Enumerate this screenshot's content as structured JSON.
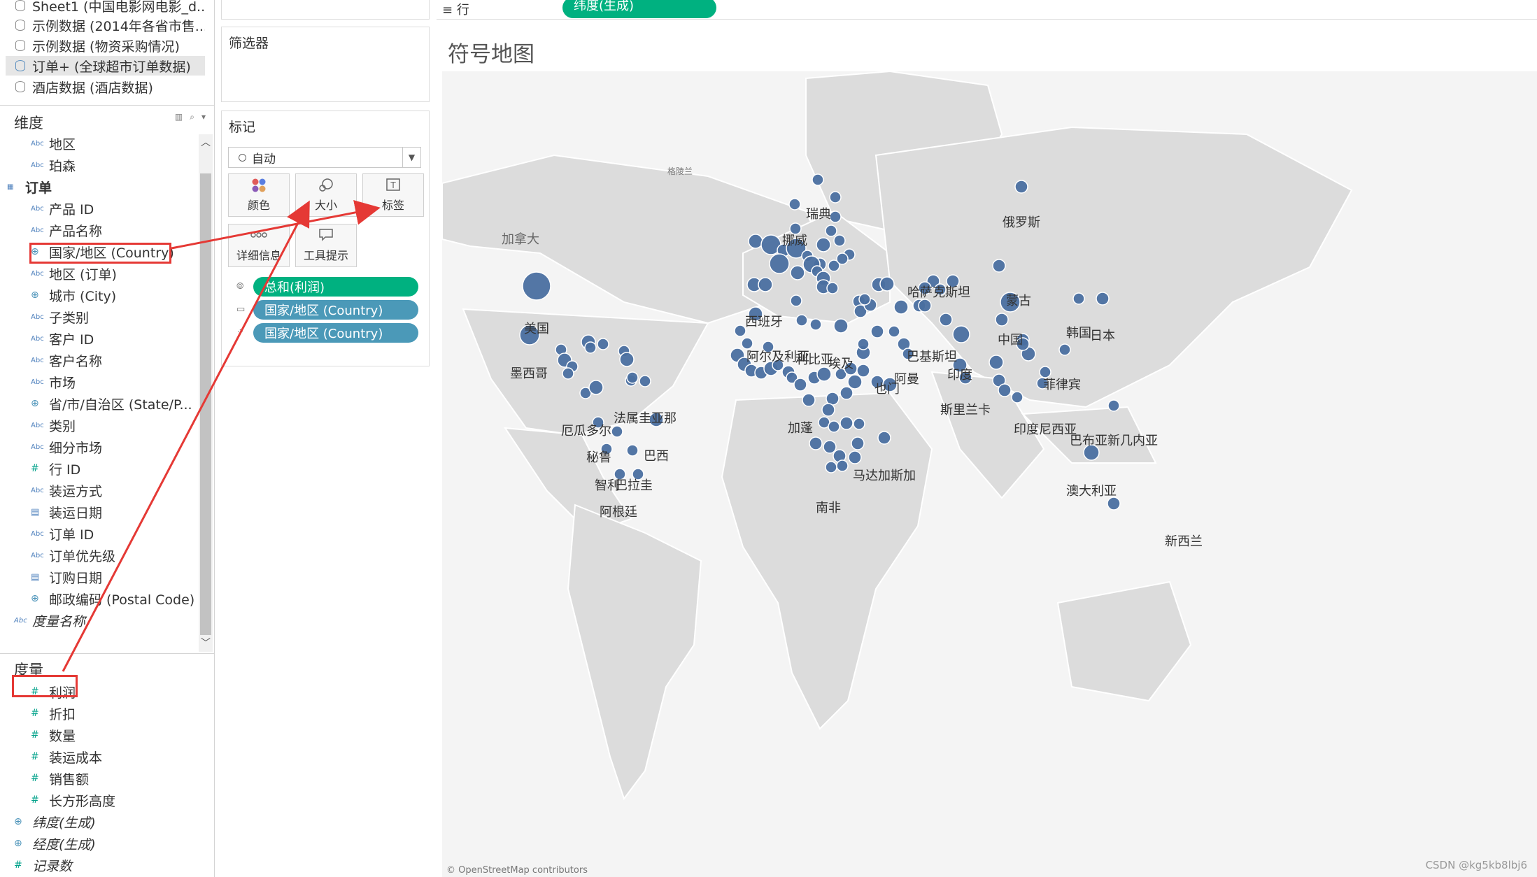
{
  "datasources": [
    {
      "label": "Sheet1 (中国电影网电影_d..."
    },
    {
      "label": "示例数据 (2014年各省市售..."
    },
    {
      "label": "示例数据 (物资采购情况)"
    },
    {
      "label": "订单+ (全球超市订单数据)"
    },
    {
      "label": "酒店数据 (酒店数据)"
    }
  ],
  "dimensions_title": "维度",
  "dimension_fields": [
    {
      "label": "地区",
      "type": "Abc"
    },
    {
      "label": "珀森",
      "type": "Abc"
    },
    {
      "label": "订单",
      "type": "group"
    },
    {
      "label": "产品 ID",
      "type": "Abc"
    },
    {
      "label": "产品名称",
      "type": "Abc"
    },
    {
      "label": "国家/地区 (Country)",
      "type": "geo"
    },
    {
      "label": "地区 (订单)",
      "type": "Abc"
    },
    {
      "label": "城市 (City)",
      "type": "geo"
    },
    {
      "label": "子类别",
      "type": "Abc"
    },
    {
      "label": "客户 ID",
      "type": "Abc"
    },
    {
      "label": "客户名称",
      "type": "Abc"
    },
    {
      "label": "市场",
      "type": "Abc"
    },
    {
      "label": "省/市/自治区 (State/P...",
      "type": "geo"
    },
    {
      "label": "类别",
      "type": "Abc"
    },
    {
      "label": "细分市场",
      "type": "Abc"
    },
    {
      "label": "行 ID",
      "type": "num"
    },
    {
      "label": "装运方式",
      "type": "Abc"
    },
    {
      "label": "装运日期",
      "type": "date"
    },
    {
      "label": "订单 ID",
      "type": "Abc"
    },
    {
      "label": "订单优先级",
      "type": "Abc"
    },
    {
      "label": "订购日期",
      "type": "date"
    },
    {
      "label": "邮政编码 (Postal Code)",
      "type": "geo"
    },
    {
      "label": "度量名称",
      "type": "Abc-italic"
    }
  ],
  "measures_title": "度量",
  "measure_fields": [
    {
      "label": "利润",
      "type": "num"
    },
    {
      "label": "折扣",
      "type": "num"
    },
    {
      "label": "数量",
      "type": "num"
    },
    {
      "label": "装运成本",
      "type": "num"
    },
    {
      "label": "销售额",
      "type": "num"
    },
    {
      "label": "长方形高度",
      "type": "num"
    },
    {
      "label": "纬度(生成)",
      "type": "geo-italic"
    },
    {
      "label": "经度(生成)",
      "type": "geo-italic"
    },
    {
      "label": "记录数",
      "type": "num-italic"
    }
  ],
  "filters_title": "筛选器",
  "marks": {
    "title": "标记",
    "type": "自动",
    "buttons": [
      {
        "label": "颜色",
        "icon": "color-icon"
      },
      {
        "label": "大小",
        "icon": "size-icon"
      },
      {
        "label": "标签",
        "icon": "label-icon"
      },
      {
        "label": "详细信息",
        "icon": "detail-icon"
      },
      {
        "label": "工具提示",
        "icon": "tooltip-icon"
      }
    ],
    "pills": [
      {
        "label": "总和(利润)",
        "color": "#00b180",
        "icon": "size-icon"
      },
      {
        "label": "国家/地区 (Country)",
        "color": "#4b99b8",
        "icon": "label-icon"
      },
      {
        "label": "国家/地区 (Country)",
        "color": "#4b99b8",
        "icon": "detail-icon"
      }
    ]
  },
  "rows_shelf": {
    "label": "行",
    "pill": "纬度(生成)"
  },
  "sheet_title": "符号地图",
  "map": {
    "attribution": "© OpenStreetMap contributors",
    "labels": [
      {
        "text": "格陵兰",
        "style": "small"
      },
      {
        "text": "加拿大",
        "style": "grey"
      },
      {
        "text": "美国"
      },
      {
        "text": "墨西哥"
      },
      {
        "text": "厄瓜多尔"
      },
      {
        "text": "法属圭亚那"
      },
      {
        "text": "巴西"
      },
      {
        "text": "秘鲁"
      },
      {
        "text": "智利"
      },
      {
        "text": "巴拉圭"
      },
      {
        "text": "阿根廷"
      },
      {
        "text": "瑞典"
      },
      {
        "text": "挪威"
      },
      {
        "text": "西班牙"
      },
      {
        "text": "阿尔及利亚"
      },
      {
        "text": "利比亚"
      },
      {
        "text": "埃及"
      },
      {
        "text": "加蓬"
      },
      {
        "text": "南非"
      },
      {
        "text": "马达加斯加"
      },
      {
        "text": "也门"
      },
      {
        "text": "阿曼"
      },
      {
        "text": "哈萨克斯坦"
      },
      {
        "text": "巴基斯坦"
      },
      {
        "text": "印度"
      },
      {
        "text": "斯里兰卡"
      },
      {
        "text": "中国"
      },
      {
        "text": "蒙古"
      },
      {
        "text": "俄罗斯"
      },
      {
        "text": "韩国"
      },
      {
        "text": "日本"
      },
      {
        "text": "菲律宾"
      },
      {
        "text": "印度尼西亚"
      },
      {
        "text": "巴布亚新几内亚"
      },
      {
        "text": "澳大利亚"
      },
      {
        "text": "新西兰"
      }
    ]
  },
  "watermark": "CSDN @kg5kb8lbj6"
}
